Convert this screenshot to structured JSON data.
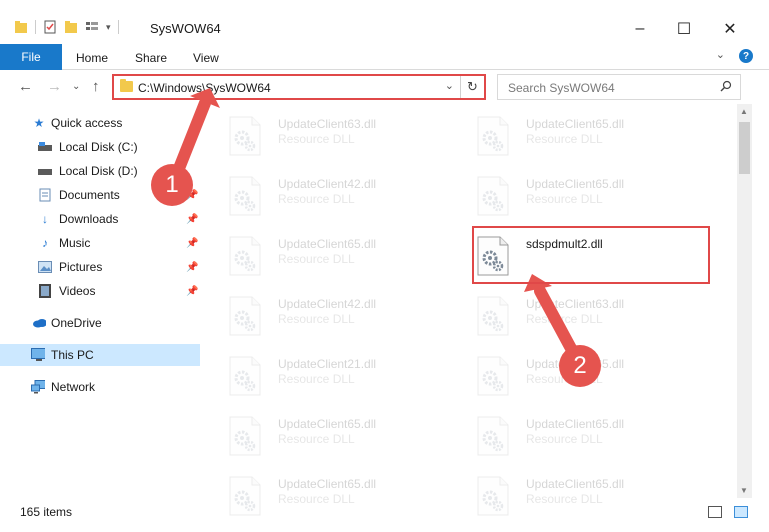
{
  "window": {
    "title": "SysWOW64"
  },
  "ribbon": {
    "tabs": [
      "File",
      "Home",
      "Share",
      "View"
    ]
  },
  "address": {
    "path": "C:\\Windows\\SysWOW64"
  },
  "search": {
    "placeholder": "Search SysWOW64"
  },
  "nav": {
    "items": [
      {
        "label": "Quick access",
        "icon": "star-icon"
      },
      {
        "label": "Local Disk (C:)",
        "icon": "drive-icon"
      },
      {
        "label": "Local Disk (D:)",
        "icon": "drive-icon"
      },
      {
        "label": "Documents",
        "icon": "documents-icon"
      },
      {
        "label": "Downloads",
        "icon": "download-icon"
      },
      {
        "label": "Music",
        "icon": "music-icon"
      },
      {
        "label": "Pictures",
        "icon": "pictures-icon"
      },
      {
        "label": "Videos",
        "icon": "videos-icon"
      },
      {
        "label": "OneDrive",
        "icon": "cloud-icon"
      },
      {
        "label": "This PC",
        "icon": "computer-icon"
      },
      {
        "label": "Network",
        "icon": "network-icon"
      }
    ]
  },
  "files": {
    "left": [
      {
        "name": "UpdateClient63.dll",
        "type": "Resource DLL"
      },
      {
        "name": "UpdateClient42.dll",
        "type": "Resource DLL"
      },
      {
        "name": "UpdateClient65.dll",
        "type": "Resource DLL"
      },
      {
        "name": "UpdateClient42.dll",
        "type": "Resource DLL"
      },
      {
        "name": "UpdateClient21.dll",
        "type": "Resource DLL"
      },
      {
        "name": "UpdateClient65.dll",
        "type": "Resource DLL"
      },
      {
        "name": "UpdateClient65.dll",
        "type": "Resource DLL"
      }
    ],
    "right": [
      {
        "name": "UpdateClient65.dll",
        "type": "Resource DLL"
      },
      {
        "name": "UpdateClient65.dll",
        "type": "Resource DLL"
      },
      {
        "name": "sdspdmult2.dll",
        "type": ""
      },
      {
        "name": "UpdateClient63.dll",
        "type": "Resource DLL"
      },
      {
        "name": "UpdateClient65.dll",
        "type": "Resource DLL"
      },
      {
        "name": "UpdateClient65.dll",
        "type": "Resource DLL"
      },
      {
        "name": "UpdateClient65.dll",
        "type": "Resource DLL"
      }
    ]
  },
  "status": {
    "count": "165 items"
  },
  "annotations": {
    "step1": "1",
    "step2": "2"
  },
  "colors": {
    "accent": "#1979ca",
    "highlight": "#e04848",
    "selected": "#cce8ff"
  }
}
